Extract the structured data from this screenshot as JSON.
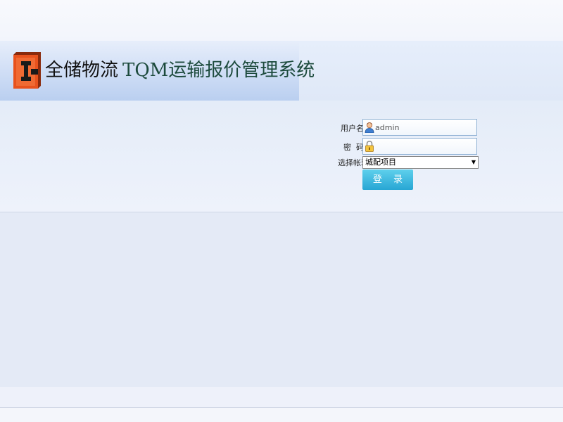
{
  "header": {
    "company_name": "全储物流",
    "system_title": "TQM运输报价管理系统"
  },
  "login": {
    "username_label": "用户名",
    "username_value": "admin",
    "password_label": "密  码",
    "password_value": "",
    "account_label": "选择帐套",
    "account_selected": "城配项目",
    "submit_label": "登 录"
  },
  "icons": {
    "logo": "company-logo-icon",
    "username": "user-icon",
    "password": "lock-icon",
    "select_arrow": "triangle-down-icon"
  },
  "colors": {
    "brand_orange": "#e8521d",
    "title_green": "#1c4a3c",
    "button_blue": "#27a6d4"
  }
}
